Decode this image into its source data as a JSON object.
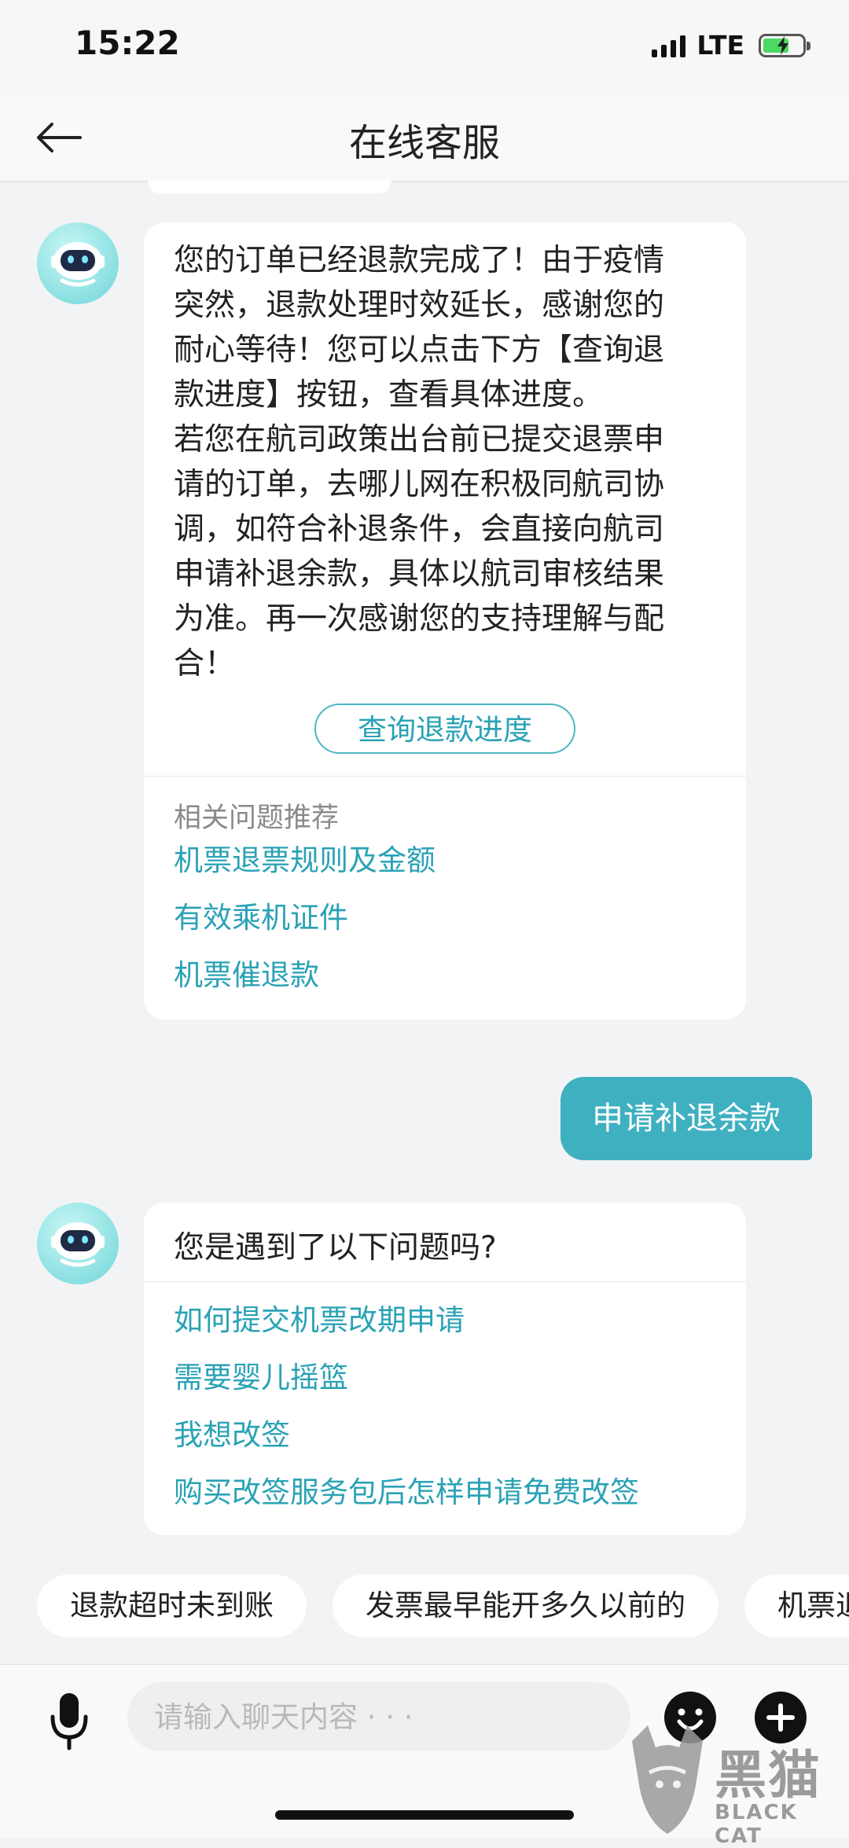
{
  "status_bar": {
    "time": "15:22",
    "network": "LTE"
  },
  "header": {
    "title": "在线客服"
  },
  "messages": {
    "bot_reply_1": {
      "text": "您的订单已经退款完成了！由于疫情突然，退款处理时效延长，感谢您的耐心等待！您可以点击下方【查询退款进度】按钮，查看具体进度。若您在航司政策出台前已提交退票申请的订单，去哪儿网在积极同航司协调，如符合补退条件，会直接向航司申请补退余款，具体以航司审核结果为准。再一次感谢您的支持理解与配合！",
      "lines": [
        "您的订单已经退款完成了！由于疫情",
        "突然，退款处理时效延长，感谢您的",
        "耐心等待！您可以点击下方【查询退",
        "款进度】按钮，查看具体进度。",
        "若您在航司政策出台前已提交退票申",
        "请的订单，去哪儿网在积极同航司协",
        "调，如符合补退条件，会直接向航司",
        "申请补退余款，具体以航司审核结果",
        "为准。再一次感谢您的支持理解与配",
        "合！"
      ],
      "button_label": "查询退款进度",
      "related_title": "相关问题推荐",
      "related": [
        "机票退票规则及金额",
        "有效乘机证件",
        "机票催退款"
      ]
    },
    "user_message": {
      "text": "申请补退余款"
    },
    "bot_reply_2": {
      "title": "您是遇到了以下问题吗?",
      "options": [
        "如何提交机票改期申请",
        "需要婴儿摇篮",
        "我想改签",
        "购买改签服务包后怎样申请免费改签"
      ]
    }
  },
  "quick_replies": [
    "退款超时未到账",
    "发票最早能开多久以前的",
    "机票退"
  ],
  "input": {
    "placeholder": "请输入聊天内容 · · ·"
  },
  "watermark": {
    "cn": "黑猫",
    "en": "BLACK CAT"
  },
  "colors": {
    "accent": "#3fb0c0",
    "link": "#2aa2b5",
    "background": "#f2f3f5"
  },
  "icons": [
    "back-arrow-icon",
    "microphone-icon",
    "emoji-icon",
    "plus-icon",
    "robot-avatar-icon",
    "signal-icon",
    "battery-charging-icon"
  ]
}
